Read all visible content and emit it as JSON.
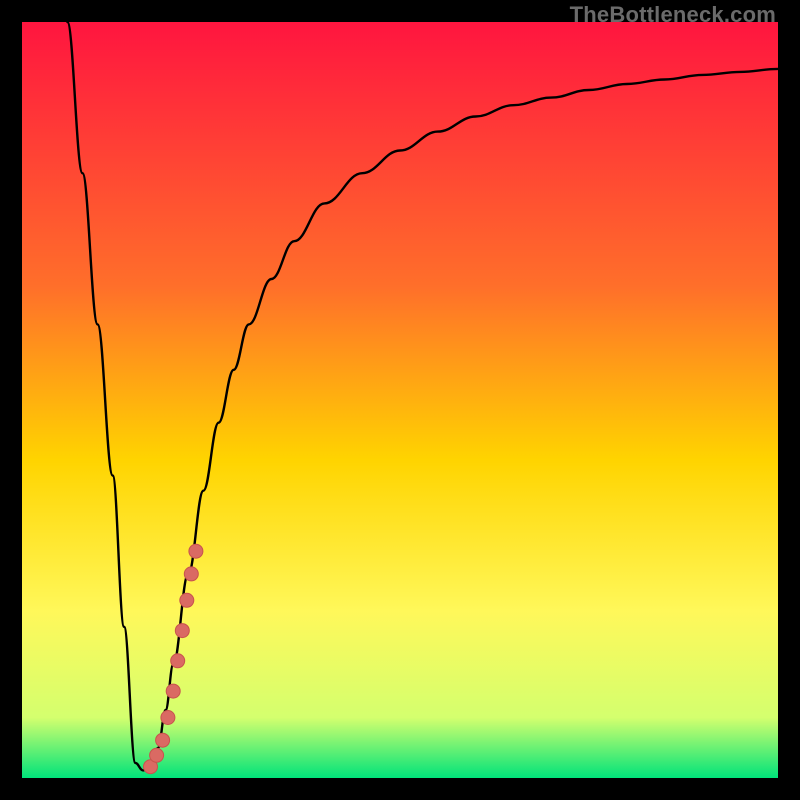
{
  "watermark": "TheBottleneck.com",
  "colors": {
    "curve": "#000000",
    "marker_fill": "#da6a63",
    "marker_stroke": "#c8534d",
    "gradient_top": "#ff153f",
    "gradient_mid1": "#ff6f2a",
    "gradient_mid2": "#ffd400",
    "gradient_mid3": "#fff85a",
    "gradient_mid4": "#d4ff6e",
    "gradient_bottom": "#00e37a"
  },
  "chart_data": {
    "type": "line",
    "title": "",
    "xlabel": "",
    "ylabel": "",
    "xlim": [
      0,
      100
    ],
    "ylim": [
      0,
      100
    ],
    "series": [
      {
        "name": "bottleneck-curve",
        "x": [
          6,
          8,
          10,
          12,
          13.5,
          15,
          16,
          17,
          18,
          19,
          20,
          22,
          24,
          26,
          28,
          30,
          33,
          36,
          40,
          45,
          50,
          55,
          60,
          65,
          70,
          75,
          80,
          85,
          90,
          95,
          100
        ],
        "y": [
          100,
          80,
          60,
          40,
          20,
          2,
          1,
          1.5,
          4,
          9,
          15,
          27,
          38,
          47,
          54,
          60,
          66,
          71,
          76,
          80,
          83,
          85.5,
          87.5,
          89,
          90,
          91,
          91.8,
          92.4,
          93,
          93.4,
          93.8
        ]
      }
    ],
    "markers": {
      "name": "highlight-points",
      "x": [
        17.0,
        17.8,
        18.6,
        19.3,
        20.0,
        20.6,
        21.2,
        21.8,
        22.4,
        23.0
      ],
      "y": [
        1.5,
        3.0,
        5.0,
        8.0,
        11.5,
        15.5,
        19.5,
        23.5,
        27.0,
        30.0
      ],
      "radius": 7
    }
  }
}
